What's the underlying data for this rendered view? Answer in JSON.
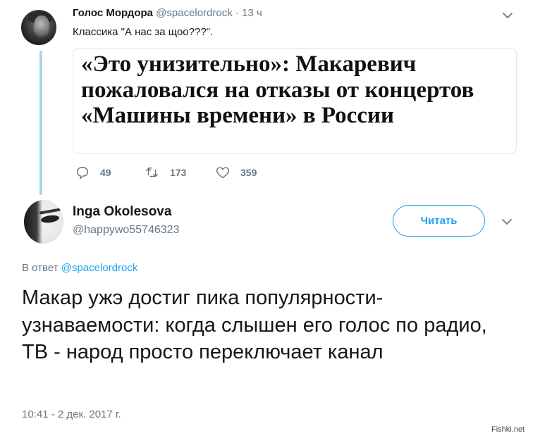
{
  "parent_tweet": {
    "author_name": "Голос Мордора",
    "handle": "@spacelordrock",
    "dot": "·",
    "time": "13 ч",
    "text": "Классика \"А нас за щоо???\".",
    "card_title": "«Это унизительно»: Макаревич пожаловался на отказы от концертов «Машины времени» в России",
    "stats": {
      "replies": "49",
      "retweets": "173",
      "likes": "359"
    },
    "icons": [
      "reply-icon",
      "retweet-icon",
      "like-icon",
      "chevron-down-icon"
    ]
  },
  "reply_tweet": {
    "author_name": "Inga Okolesova",
    "handle": "@happywo55746323",
    "follow_label": "Читать",
    "reply_prefix": "В ответ",
    "reply_mention": "@spacelordrock",
    "text": "Макар ужэ достиг пика популярности-узнаваемости: когда слышен его голос по радио, ТВ - народ  просто переключает канал",
    "timestamp": "10:41 - 2 дек. 2017 г."
  },
  "watermark": "Fishki.net",
  "colors": {
    "accent": "#1da1f2",
    "secondary_text": "#657786",
    "thread_line": "#a6d4ef",
    "primary_text": "#14171a"
  }
}
